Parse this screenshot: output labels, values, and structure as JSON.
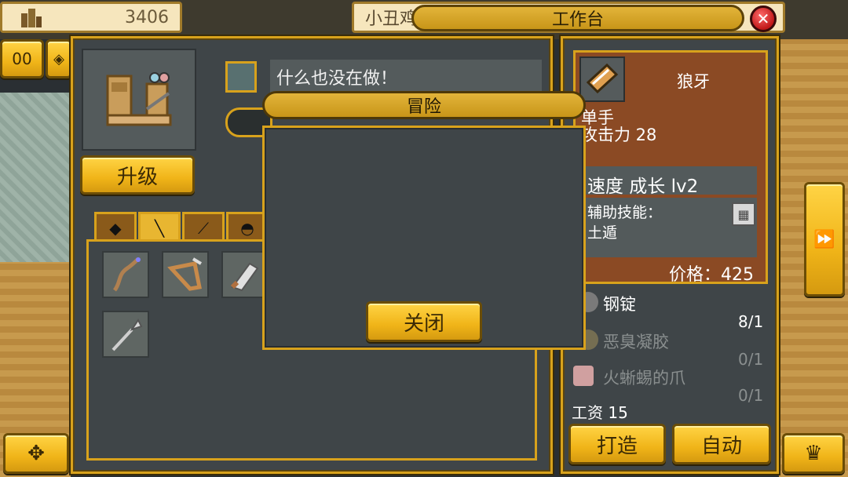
{
  "topbar": {
    "gold_amount": "3406",
    "partner_name": "小丑鸡",
    "window_title": "工作台",
    "close_icon": "close-x-icon"
  },
  "left": {
    "hud_button_label": "00",
    "upgrade_label": "升级",
    "status_text": "什么也没在做！",
    "tabs": [
      {
        "icon": "shield-icon",
        "active": false
      },
      {
        "icon": "staff-icon",
        "active": true
      },
      {
        "icon": "wand-icon",
        "active": false
      },
      {
        "icon": "helmet-icon",
        "active": false
      }
    ],
    "inventory_icons": [
      "staff-item-icon",
      "saw-item-icon",
      "blade-item-icon",
      "spear-item-icon"
    ]
  },
  "item": {
    "name": "狼牙",
    "hand": "单手",
    "attack_label": "攻击力 28",
    "speed_growth": "速度 成长 lv2",
    "assist_skill_label": "辅助技能：",
    "skill_name": "土遁",
    "price_label": "价格：425",
    "materials": [
      {
        "name": "钢锭",
        "count": "8/1",
        "available": true
      },
      {
        "name": "恶臭凝胶",
        "count": "0/1",
        "available": false
      },
      {
        "name": "火蜥蜴的爪",
        "count": "0/1",
        "available": false
      }
    ],
    "wage_label": "工资 15"
  },
  "actions": {
    "craft_label": "打造",
    "auto_label": "自动"
  },
  "dialog": {
    "title": "冒险",
    "close_label": "关闭"
  },
  "colors": {
    "gold": "#d8a21c",
    "button_fill": "#f0b418",
    "panel": "#3f4548",
    "card": "#8b4a24"
  }
}
